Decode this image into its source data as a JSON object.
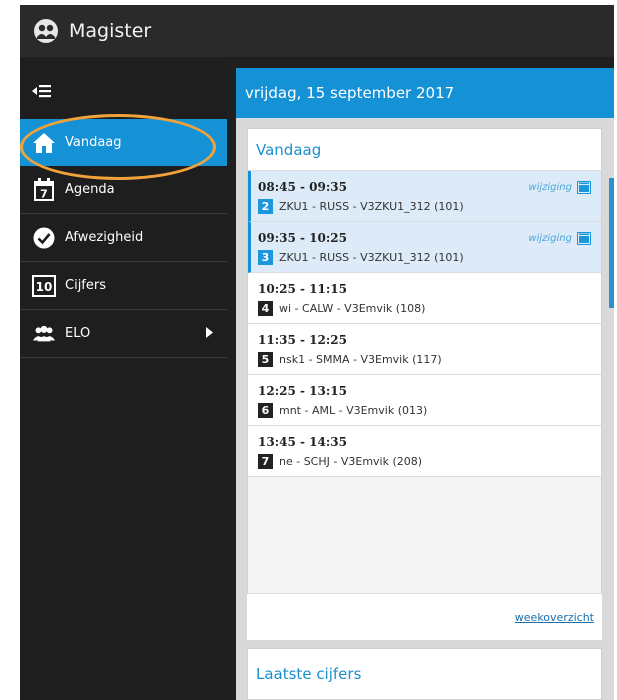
{
  "app": {
    "title": "Magister",
    "logo_icon": "magister-logo-icon"
  },
  "sidebar": {
    "collapse_icon": "collapse-menu-icon",
    "items": [
      {
        "label": "Vandaag",
        "icon": "house-icon",
        "active": true
      },
      {
        "label": "Agenda",
        "icon": "calendar-icon",
        "icon_text": "7"
      },
      {
        "label": "Afwezigheid",
        "icon": "checkmark-icon"
      },
      {
        "label": "Cijfers",
        "icon": "grade-icon",
        "icon_text": "10"
      },
      {
        "label": "ELO",
        "icon": "people-icon",
        "has_submenu": true
      }
    ]
  },
  "main": {
    "date": "vrijdag, 15 september 2017",
    "today_card": {
      "title": "Vandaag",
      "lessons": [
        {
          "time": "08:45 - 09:35",
          "hour": "2",
          "desc": "ZKU1 - RUSS - V3ZKU1_312 (101)",
          "changed": true,
          "change_label": "wijziging"
        },
        {
          "time": "09:35 - 10:25",
          "hour": "3",
          "desc": "ZKU1 - RUSS - V3ZKU1_312 (101)",
          "changed": true,
          "change_label": "wijziging"
        },
        {
          "time": "10:25 - 11:15",
          "hour": "4",
          "desc": "wi - CALW - V3Emvik (108)",
          "changed": false
        },
        {
          "time": "11:35 - 12:25",
          "hour": "5",
          "desc": "nsk1 - SMMA - V3Emvik (117)",
          "changed": false
        },
        {
          "time": "12:25 - 13:15",
          "hour": "6",
          "desc": "mnt - AML - V3Emvik (013)",
          "changed": false
        },
        {
          "time": "13:45 - 14:35",
          "hour": "7",
          "desc": "ne - SCHJ - V3Emvik (208)",
          "changed": false
        }
      ],
      "footer_link": "weekoverzicht"
    },
    "grades_card": {
      "title": "Laatste cijfers"
    }
  },
  "colors": {
    "accent": "#1591d6",
    "highlight_ring": "#f2a23a",
    "sidebar_bg": "#1e1e1e"
  }
}
